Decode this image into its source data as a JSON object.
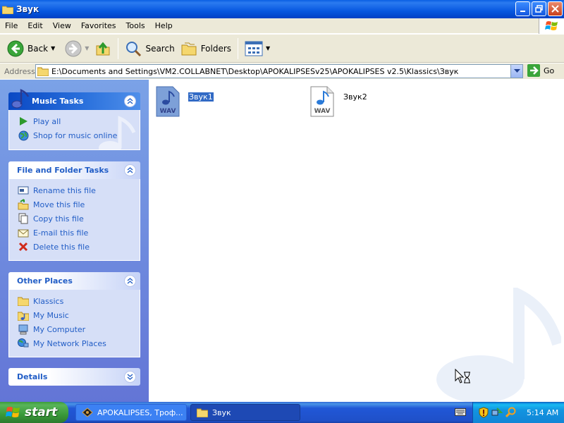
{
  "window": {
    "title": "Звук"
  },
  "menu": [
    "File",
    "Edit",
    "View",
    "Favorites",
    "Tools",
    "Help"
  ],
  "toolbar": {
    "back": "Back",
    "search": "Search",
    "folders": "Folders"
  },
  "address": {
    "label": "Address",
    "value": "E:\\Documents and Settings\\VM2.COLLABNET\\Desktop\\APOKALIPSESv25\\APOKALIPSES v2.5\\Klassics\\Звук",
    "go": "Go"
  },
  "taskpane": {
    "music_tasks": {
      "title": "Music Tasks",
      "items": [
        "Play all",
        "Shop for music online"
      ]
    },
    "file_tasks": {
      "title": "File and Folder Tasks",
      "items": [
        "Rename this file",
        "Move this file",
        "Copy this file",
        "E-mail this file",
        "Delete this file"
      ]
    },
    "other_places": {
      "title": "Other Places",
      "items": [
        "Klassics",
        "My Music",
        "My Computer",
        "My Network Places"
      ]
    },
    "details": {
      "title": "Details"
    }
  },
  "files": [
    {
      "name": "Звук1",
      "type_label": "WAV",
      "selected": true
    },
    {
      "name": "Звук2",
      "type_label": "WAV",
      "selected": false
    }
  ],
  "taskbar": {
    "start": "start",
    "tasks": [
      {
        "label": "APOKALIPSES, Троф...",
        "active": false
      },
      {
        "label": "Звук",
        "active": true
      }
    ],
    "clock": "5:14 AM"
  },
  "colors": {
    "titlebar": "#0058e6",
    "taskpane_bg": "#6f8fde",
    "link": "#215dc6",
    "selection": "#316ac5",
    "start_green": "#3a9a3a"
  }
}
